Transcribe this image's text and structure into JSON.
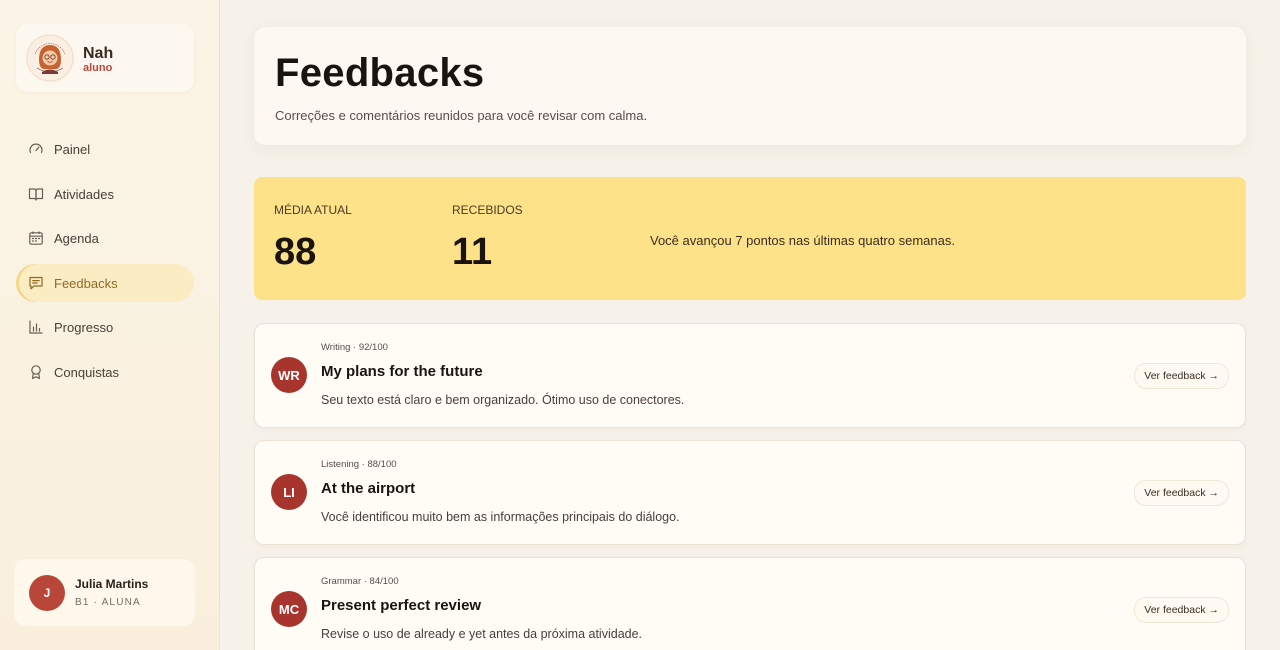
{
  "brand": {
    "name": "Nah",
    "role": "aluno",
    "logo_icon": "teacher-avatar-logo"
  },
  "nav": {
    "items": [
      {
        "label": "Painel",
        "icon": "gauge-icon"
      },
      {
        "label": "Atividades",
        "icon": "book-icon"
      },
      {
        "label": "Agenda",
        "icon": "calendar-icon"
      },
      {
        "label": "Feedbacks",
        "icon": "message-icon",
        "active": true
      },
      {
        "label": "Progresso",
        "icon": "bar-chart-icon"
      },
      {
        "label": "Conquistas",
        "icon": "award-icon"
      }
    ]
  },
  "user": {
    "initial": "J",
    "name": "Julia Martins",
    "meta": "B1 · ALUNA"
  },
  "header": {
    "title": "Feedbacks",
    "subtitle": "Correções e comentários reunidos para você revisar com calma."
  },
  "stats": {
    "average_label": "MÉDIA ATUAL",
    "average_value": "88",
    "received_label": "RECEBIDOS",
    "received_value": "11",
    "note": "Você avançou 7 pontos nas últimas quatro semanas."
  },
  "feedbacks": [
    {
      "initials": "WR",
      "meta": "Writing · 92/100",
      "title": "My plans for the future",
      "description": "Seu texto está claro e bem organizado. Ótimo uso de conectores.",
      "button": "Ver feedback →"
    },
    {
      "initials": "LI",
      "meta": "Listening · 88/100",
      "title": "At the airport",
      "description": "Você identificou muito bem as informações principais do diálogo.",
      "button": "Ver feedback →"
    },
    {
      "initials": "MC",
      "meta": "Grammar · 84/100",
      "title": "Present perfect review",
      "description": "Revise o uso de already e yet antes da próxima atividade.",
      "button": "Ver feedback →"
    }
  ],
  "colors": {
    "accent": "#b8473a",
    "stats_bg": "#fde28a",
    "active_nav": "#fbecc4",
    "avatar": "#a8352d"
  }
}
